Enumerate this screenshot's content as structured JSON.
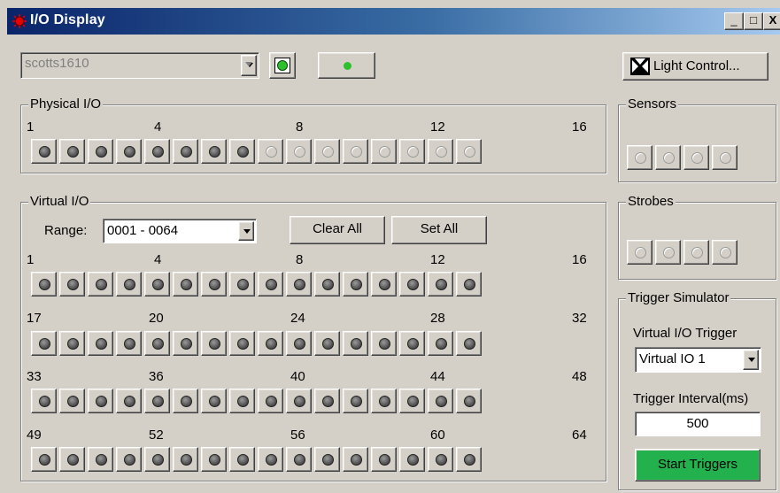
{
  "window": {
    "title": "I/O Display"
  },
  "titlebar_buttons": {
    "minimize": "_",
    "maximize": "□",
    "close": "X"
  },
  "device": {
    "selected": "scotts1610"
  },
  "light_control": {
    "label": "Light Control..."
  },
  "physical": {
    "title": "Physical I/O",
    "markers": [
      "1",
      "4",
      "8",
      "12",
      "16"
    ],
    "states": [
      1,
      1,
      1,
      1,
      1,
      1,
      1,
      1,
      0,
      0,
      0,
      0,
      0,
      0,
      0,
      0
    ]
  },
  "virtual": {
    "title": "Virtual I/O",
    "range_label": "Range:",
    "range_value": "0001 - 0064",
    "clear_all": "Clear All",
    "set_all": "Set All",
    "rows": [
      {
        "markers": [
          "1",
          "4",
          "8",
          "12",
          "16"
        ],
        "states": [
          1,
          1,
          1,
          1,
          1,
          1,
          1,
          1,
          1,
          1,
          1,
          1,
          1,
          1,
          1,
          1
        ]
      },
      {
        "markers": [
          "17",
          "20",
          "24",
          "28",
          "32"
        ],
        "states": [
          1,
          1,
          1,
          1,
          1,
          1,
          1,
          1,
          1,
          1,
          1,
          1,
          1,
          1,
          1,
          1
        ]
      },
      {
        "markers": [
          "33",
          "36",
          "40",
          "44",
          "48"
        ],
        "states": [
          1,
          1,
          1,
          1,
          1,
          1,
          1,
          1,
          1,
          1,
          1,
          1,
          1,
          1,
          1,
          1
        ]
      },
      {
        "markers": [
          "49",
          "52",
          "56",
          "60",
          "64"
        ],
        "states": [
          1,
          1,
          1,
          1,
          1,
          1,
          1,
          1,
          1,
          1,
          1,
          1,
          1,
          1,
          1,
          1
        ]
      }
    ]
  },
  "sensors": {
    "title": "Sensors",
    "states": [
      0,
      0,
      0,
      0
    ]
  },
  "strobes": {
    "title": "Strobes",
    "states": [
      0,
      0,
      0,
      0
    ]
  },
  "trigger": {
    "title": "Trigger Simulator",
    "virtual_label": "Virtual I/O Trigger",
    "virtual_value": "Virtual IO 1",
    "interval_label": "Trigger Interval(ms)",
    "interval_value": "500",
    "start_label": "Start Triggers"
  },
  "colors": {
    "start_button": "#22b14c",
    "status_led": "#2ec02e"
  }
}
